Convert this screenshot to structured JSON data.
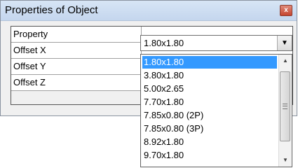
{
  "window": {
    "title": "Properties of Object",
    "close_symbol": "x"
  },
  "grid": {
    "rows": [
      {
        "label": "Property"
      },
      {
        "label": "Offset X"
      },
      {
        "label": "Offset Y"
      },
      {
        "label": "Offset Z"
      }
    ]
  },
  "combo": {
    "selected_value": "1.80x1.80"
  },
  "dropdown": {
    "options": [
      "1.80x1.80",
      "3.80x1.80",
      "5.00x2.65",
      "7.70x1.80",
      "7.85x0.80 (2P)",
      "7.85x0.80 (3P)",
      "8.92x1.80",
      "9.70x1.80"
    ],
    "highlighted_index": 0
  },
  "icons": {
    "combo_arrow": "chevron-down-icon",
    "scroll_up": "scroll-up-arrow-icon",
    "scroll_down": "scroll-down-arrow-icon"
  },
  "colors": {
    "selection": "#3399ff",
    "titlebar": "#c4d6ee",
    "close": "#c5442f"
  }
}
